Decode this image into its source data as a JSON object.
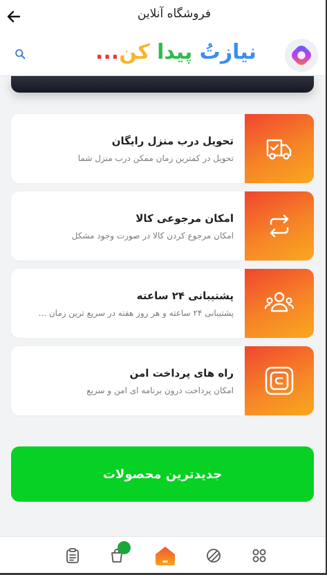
{
  "header": {
    "title": "فروشگاه آنلاین",
    "logo_parts": [
      "نیازتُ",
      " پیدا ",
      "کن",
      "..."
    ]
  },
  "features": [
    {
      "title": "تحویل درب منزل رایگان",
      "description": "تحویل در کمترین زمان ممکن درب منزل شما",
      "icon": "truck-check-icon"
    },
    {
      "title": "امکان مرجوعی کالا",
      "description": "امکان مرجوع کردن کالا در صورت وجود مشکل",
      "icon": "refresh-icon"
    },
    {
      "title": "پشتیبانی ۲۴ ساعته",
      "description": "پشتیبانی ۲۴ ساعته و هر روز هفته در سریع ترین زمان ...",
      "icon": "support-users-icon"
    },
    {
      "title": "راه های پرداخت امن",
      "description": "امکان پرداخت درون برنامه ای امن و سریع",
      "icon": "secure-payment-icon"
    }
  ],
  "cta": {
    "label": "جدیدترین محصولات"
  },
  "colors": {
    "accent_gradient_start": "#f0462e",
    "accent_gradient_end": "#f9a81f",
    "cta_green": "#07d122",
    "badge_green": "#1aa83a"
  },
  "bottom_nav": {
    "items": [
      "orders-icon",
      "cart-icon",
      "home-icon",
      "categories-icon",
      "menu-grid-icon"
    ]
  }
}
